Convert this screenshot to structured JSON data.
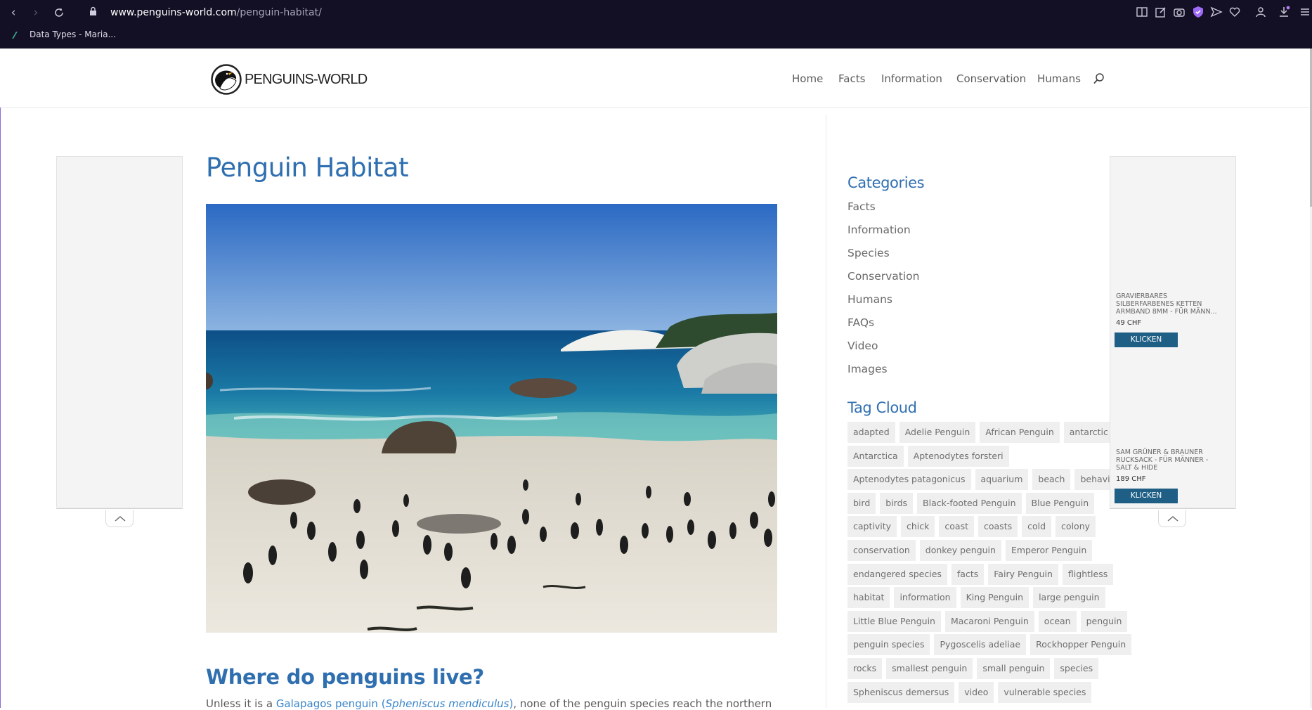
{
  "browser": {
    "url_host": "www.penguins-world.com",
    "url_path": "/penguin-habitat/",
    "bookmark": "Data Types - Maria..."
  },
  "site": {
    "logo_text": "PENGUINS-WORLD",
    "nav": [
      "Home",
      "Facts",
      "Information",
      "Conservation",
      "Humans"
    ]
  },
  "main": {
    "title": "Penguin Habitat",
    "subtitle": "Where do penguins live?",
    "para_start": "Unless it is a ",
    "para_link": "Galapagos penguin (",
    "para_italic": "Spheniscus mendiculus",
    "para_link_end": ")",
    "para_end": ", none of the penguin species reach the northern"
  },
  "sidebar": {
    "categories_title": "Categories",
    "categories": [
      "Facts",
      "Information",
      "Species",
      "Conservation",
      "Humans",
      "FAQs",
      "Video",
      "Images"
    ],
    "tagcloud_title": "Tag Cloud",
    "tags": [
      [
        "adapted",
        "Adelie Penguin",
        "African Penguin",
        "antarctic"
      ],
      [
        "Antarctica",
        "Aptenodytes forsteri"
      ],
      [
        "Aptenodytes patagonicus",
        "aquarium",
        "beach",
        "behavior"
      ],
      [
        "bird",
        "birds",
        "Black-footed Penguin",
        "Blue Penguin"
      ],
      [
        "captivity",
        "chick",
        "coast",
        "coasts",
        "cold",
        "colony"
      ],
      [
        "conservation",
        "donkey penguin",
        "Emperor Penguin"
      ],
      [
        "endangered species",
        "facts",
        "Fairy Penguin",
        "flightless"
      ],
      [
        "habitat",
        "information",
        "King Penguin",
        "large penguin"
      ],
      [
        "Little Blue Penguin",
        "Macaroni Penguin",
        "ocean",
        "penguin"
      ],
      [
        "penguin species",
        "Pygoscelis adeliae",
        "Rockhopper Penguin"
      ],
      [
        "rocks",
        "smallest penguin",
        "small penguin",
        "species"
      ],
      [
        "Spheniscus demersus",
        "video",
        "vulnerable species"
      ]
    ]
  },
  "ad_right": {
    "product1": "GRAVIERBARES SILBERFARBENES KETTEN ARMBAND 8MM - FÜR MÄNN...",
    "price1": "49 CHF",
    "button1": "KLICKEN",
    "product2": "SAM GRÜNER & BRAUNER RUCKSACK - FÜR MÄNNER - SALT & HIDE",
    "price2": "189 CHF",
    "button2": "KLICKEN"
  },
  "colors": {
    "browser_bg": "#130f24",
    "accent_blue": "#2f6fb0",
    "button_blue": "#1f5f85"
  }
}
